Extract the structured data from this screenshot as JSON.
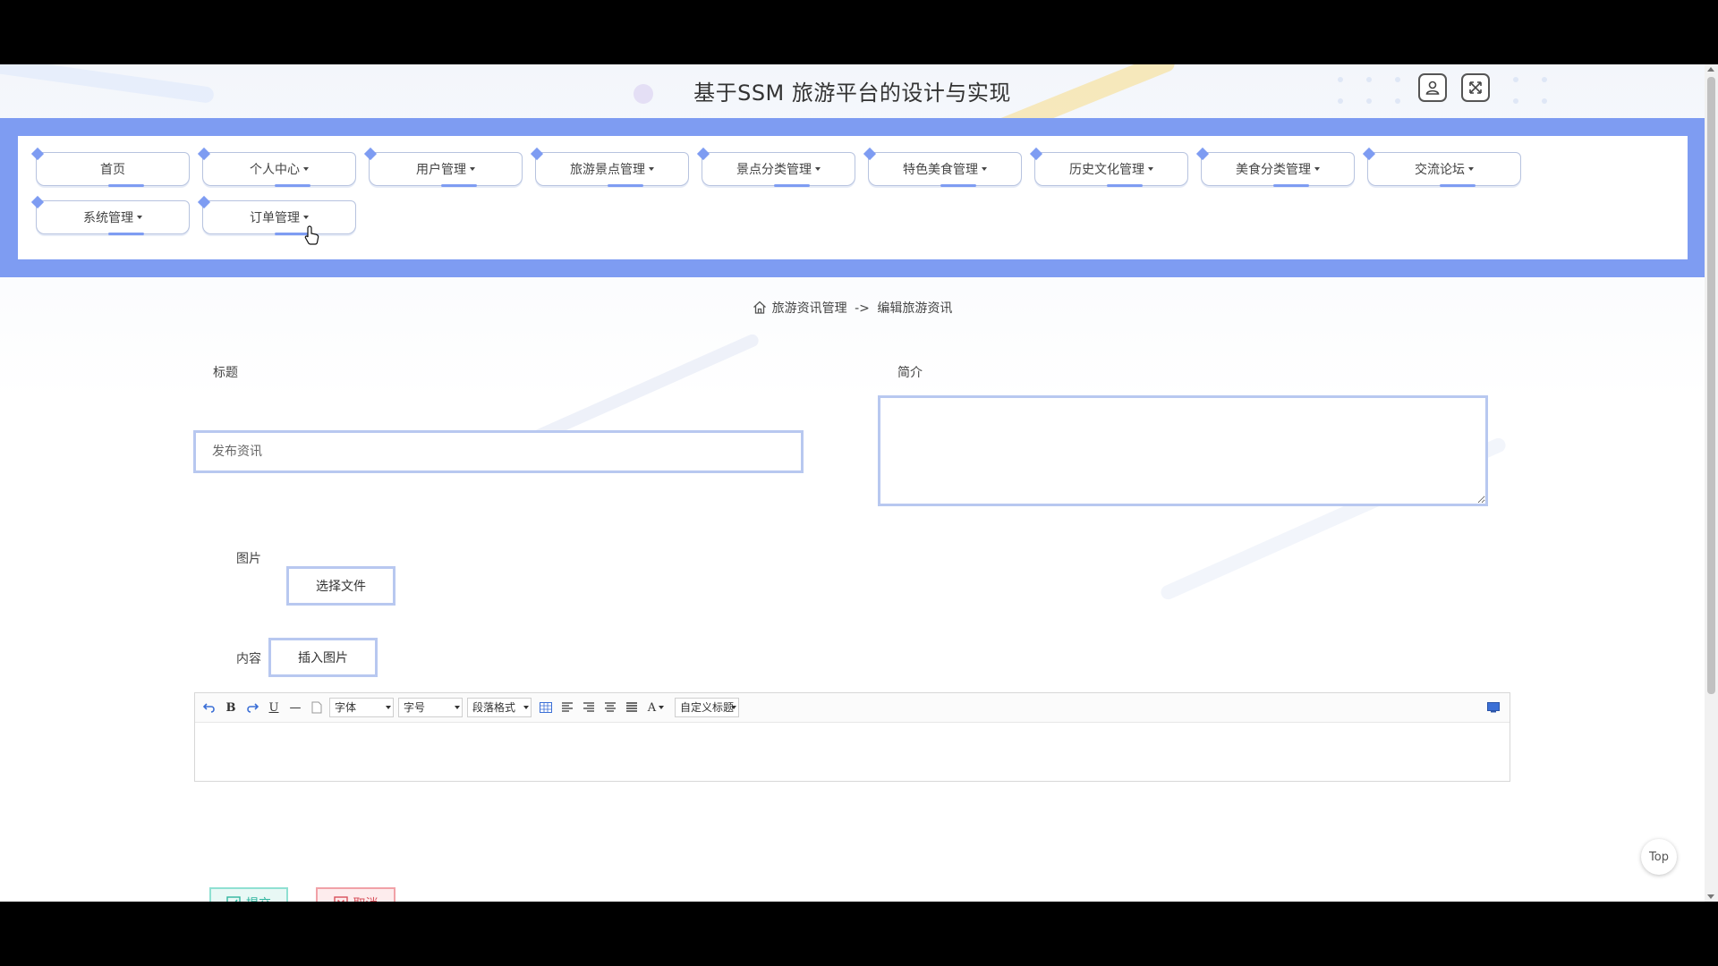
{
  "header": {
    "title": "基于SSM 旅游平台的设计与实现",
    "user_icon": "user-icon",
    "fullscreen_icon": "fullscreen-icon"
  },
  "nav": {
    "items": [
      {
        "label": "首页",
        "has_dropdown": false
      },
      {
        "label": "个人中心",
        "has_dropdown": true
      },
      {
        "label": "用户管理",
        "has_dropdown": true
      },
      {
        "label": "旅游景点管理",
        "has_dropdown": true
      },
      {
        "label": "景点分类管理",
        "has_dropdown": true
      },
      {
        "label": "特色美食管理",
        "has_dropdown": true
      },
      {
        "label": "历史文化管理",
        "has_dropdown": true
      },
      {
        "label": "美食分类管理",
        "has_dropdown": true
      },
      {
        "label": "交流论坛",
        "has_dropdown": true
      },
      {
        "label": "系统管理",
        "has_dropdown": true
      },
      {
        "label": "订单管理",
        "has_dropdown": true
      }
    ]
  },
  "breadcrumb": {
    "icon": "home-icon",
    "section": "旅游资讯管理",
    "separator": "->",
    "current": "编辑旅游资讯"
  },
  "form": {
    "title_label": "标题",
    "title_placeholder": "发布资讯",
    "intro_label": "简介",
    "image_label": "图片",
    "choose_file": "选择文件",
    "content_label": "内容",
    "insert_image": "插入图片"
  },
  "editor": {
    "font_family": "字体",
    "font_size": "字号",
    "paragraph_format": "段落格式",
    "custom_title": "自定义标题",
    "font_color": "A",
    "bold": "B",
    "underline": "U",
    "hr": "—"
  },
  "actions": {
    "submit": "提交",
    "cancel": "取消"
  },
  "top_button": "Top",
  "colors": {
    "nav_band": "#7e9cf2",
    "input_border": "#b8c8f0",
    "submit": "#54c9b5",
    "cancel": "#e0626c"
  }
}
